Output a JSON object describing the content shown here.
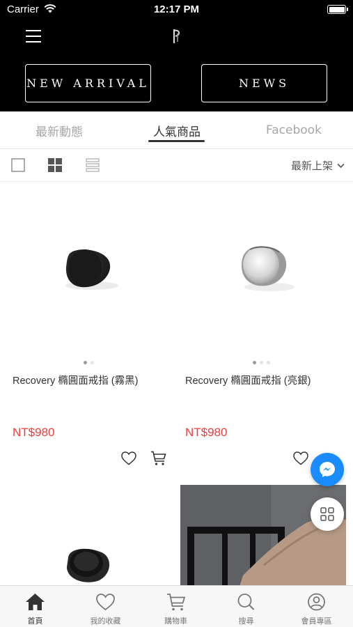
{
  "status_bar": {
    "carrier": "Carrier",
    "time": "12:17 PM"
  },
  "header": {
    "new_arrival_label": "NEW ARRIVAL",
    "news_label": "NEWS"
  },
  "tabs": [
    {
      "label": "最新動態"
    },
    {
      "label": "人氣商品",
      "active": true
    },
    {
      "label": "Facebook"
    }
  ],
  "toolbar": {
    "sort_label": "最新上架"
  },
  "products": [
    {
      "name": "Recovery 橢圓面戒指 (霧黑)",
      "price": "NT$980"
    },
    {
      "name": "Recovery 橢圓面戒指 (亮銀)",
      "price": "NT$980"
    }
  ],
  "bottom_nav": [
    {
      "label": "首頁",
      "icon": "home-icon",
      "active": true
    },
    {
      "label": "我的收藏",
      "icon": "heart-icon"
    },
    {
      "label": "購物車",
      "icon": "cart-icon"
    },
    {
      "label": "搜尋",
      "icon": "search-icon"
    },
    {
      "label": "會員專區",
      "icon": "user-icon"
    }
  ],
  "colors": {
    "header_bg": "#000000",
    "price": "#ee3b3b",
    "messenger": "#1a8cff"
  }
}
